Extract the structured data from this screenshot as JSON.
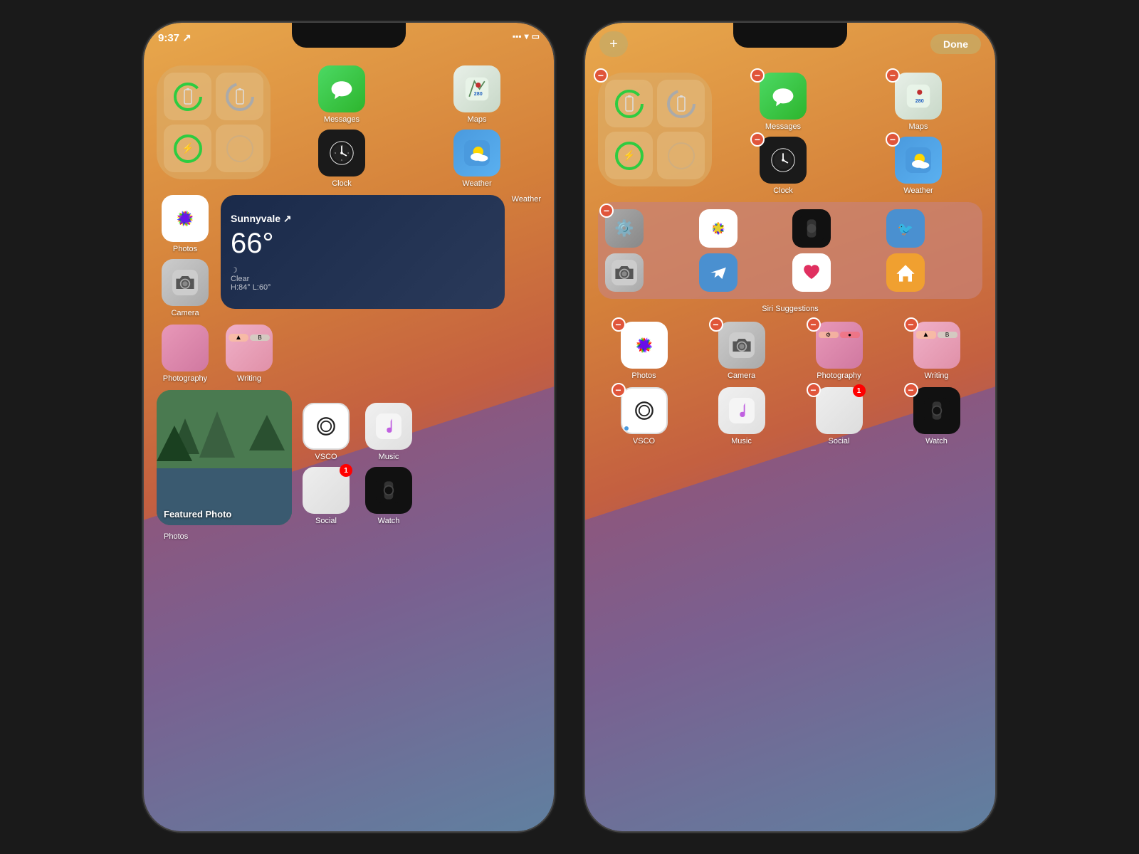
{
  "phones": [
    {
      "id": "phone-normal",
      "status": {
        "time": "9:37",
        "location": "↗",
        "signal": "▪▪▪",
        "wifi": "wifi",
        "battery": "battery"
      },
      "rows": [
        {
          "type": "mixed",
          "items": [
            {
              "type": "batteries-widget",
              "label": "Batteries"
            },
            {
              "type": "app",
              "icon": "messages",
              "label": "Messages",
              "color": "#4cd964"
            },
            {
              "type": "app",
              "icon": "maps",
              "label": "Maps",
              "color": "#eee"
            }
          ]
        },
        {
          "type": "mixed",
          "items": [
            {
              "type": "spacer"
            },
            {
              "type": "app",
              "icon": "clock",
              "label": "Clock",
              "color": "#1a1a1a"
            },
            {
              "type": "app",
              "icon": "weather",
              "label": "Weather",
              "color": "#4a9ade"
            }
          ]
        },
        {
          "type": "row",
          "items": [
            {
              "type": "app",
              "icon": "photos",
              "label": "Photos",
              "color": "#fff"
            },
            {
              "type": "app",
              "icon": "camera",
              "label": "Camera",
              "color": "#ccc"
            },
            {
              "type": "weather-widget",
              "city": "Sunnyvale ↗",
              "temp": "66°",
              "condition": "Clear",
              "hl": "H:84° L:60°",
              "label": "Weather"
            }
          ]
        },
        {
          "type": "row",
          "items": [
            {
              "type": "app",
              "icon": "photography",
              "label": "Photography",
              "color": "#e898b8"
            },
            {
              "type": "app",
              "icon": "writing",
              "label": "Writing",
              "color": "#f0b0c0"
            },
            {
              "type": "spacer"
            }
          ]
        },
        {
          "type": "bottom-row",
          "items": [
            {
              "type": "featured-photo",
              "label": "Featured Photo",
              "sublabel": "Photos"
            },
            {
              "type": "app",
              "icon": "vsco",
              "label": "VSCO",
              "color": "#fff"
            },
            {
              "type": "app",
              "icon": "music",
              "label": "Music",
              "color": "#f0f0f0"
            },
            {
              "type": "app",
              "icon": "social",
              "label": "Social",
              "color": "#ddd",
              "badge": 1
            },
            {
              "type": "app",
              "icon": "watch",
              "label": "Watch",
              "color": "#111"
            }
          ]
        }
      ],
      "dock": [
        {
          "icon": "phone",
          "color": "#4cd964"
        },
        {
          "icon": "safari",
          "color": "#4a9ade"
        },
        {
          "icon": "messages2",
          "color": "#4cd964"
        },
        {
          "icon": "music2",
          "color": "#f0f0f0"
        }
      ]
    },
    {
      "id": "phone-edit",
      "editMode": true,
      "topBar": {
        "addLabel": "+",
        "doneLabel": "Done"
      }
    }
  ],
  "labels": {
    "batteries": "Batteries",
    "messages": "Messages",
    "maps": "Maps",
    "clock": "Clock",
    "weather": "Weather",
    "photos": "Photos",
    "camera": "Camera",
    "photography": "Photography",
    "writing": "Writing",
    "vsco": "VSCO",
    "music": "Music",
    "social": "Social",
    "watch": "Watch",
    "featured_photo": "Featured Photo",
    "siri_suggestions": "Siri Suggestions",
    "done": "Done",
    "add": "+",
    "weather_city": "Sunnyvale ↗",
    "weather_temp": "66°",
    "weather_condition": "Clear",
    "weather_hl": "H:84° L:60°"
  }
}
